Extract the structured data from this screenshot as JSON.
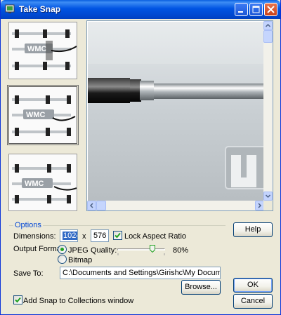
{
  "window": {
    "title": "Take Snap"
  },
  "options": {
    "group_label": "Options",
    "dimensions_label": "Dimensions:",
    "width_value": "1024",
    "x_label": "x",
    "height_value": "576",
    "lock_aspect_label": "Lock Aspect Ratio",
    "lock_aspect_checked": true,
    "output_format_label": "Output Format:",
    "format_jpeg_label": "JPEG",
    "format_bitmap_label": "Bitmap",
    "selected_format": "JPEG",
    "quality_label": "Quality:",
    "quality_value": "80%",
    "save_to_label": "Save To:",
    "save_path": "C:\\Documents and Settings\\Girishc\\My Documents\\MySnap.jp",
    "browse_label": "Browse...",
    "add_to_collections_label": "Add Snap to Collections window",
    "add_to_collections_checked": true
  },
  "buttons": {
    "help": "Help",
    "ok": "OK",
    "cancel": "Cancel"
  },
  "thumbnails": {
    "count": 3,
    "selected_index": 1
  },
  "colors": {
    "title_bar": "#0054e3",
    "dialog_bg": "#ece9d8",
    "group_label": "#0046d5",
    "selection": "#316ac5"
  },
  "icons": [
    "app-icon",
    "minimize-icon",
    "maximize-icon",
    "close-icon",
    "scroll-up-icon",
    "scroll-down-icon",
    "scroll-left-icon",
    "scroll-right-icon"
  ]
}
